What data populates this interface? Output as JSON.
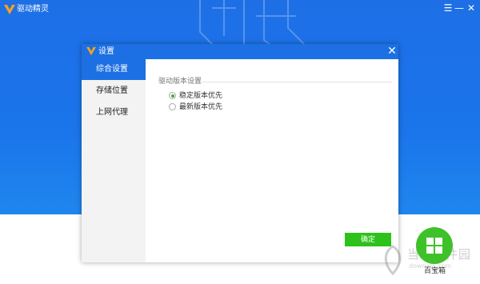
{
  "app": {
    "title": "驱动精灵",
    "logo_icon": "v-logo-icon",
    "header_color": "#1e6fe6"
  },
  "window_controls": {
    "menu_glyph": "☰",
    "minimize_glyph": "—",
    "close_glyph": "✕"
  },
  "dialog": {
    "title": "设置",
    "close_glyph": "✕",
    "nav": {
      "items": [
        {
          "label": "综合设置",
          "active": true
        },
        {
          "label": "存储位置",
          "active": false
        },
        {
          "label": "上网代理",
          "active": false
        }
      ]
    },
    "section": {
      "label": "驱动版本设置",
      "options": [
        {
          "label": "稳定版本优先",
          "checked": true
        },
        {
          "label": "最新版本优先",
          "checked": false
        }
      ]
    },
    "ok_label": "确定",
    "ok_color": "#2cc21a",
    "accent_color": "#1c70e3"
  },
  "toolbox": {
    "label": "百宝箱",
    "icon": "grid-icon"
  },
  "watermark": {
    "text": "当下软件园",
    "sub": "downxia.com"
  }
}
